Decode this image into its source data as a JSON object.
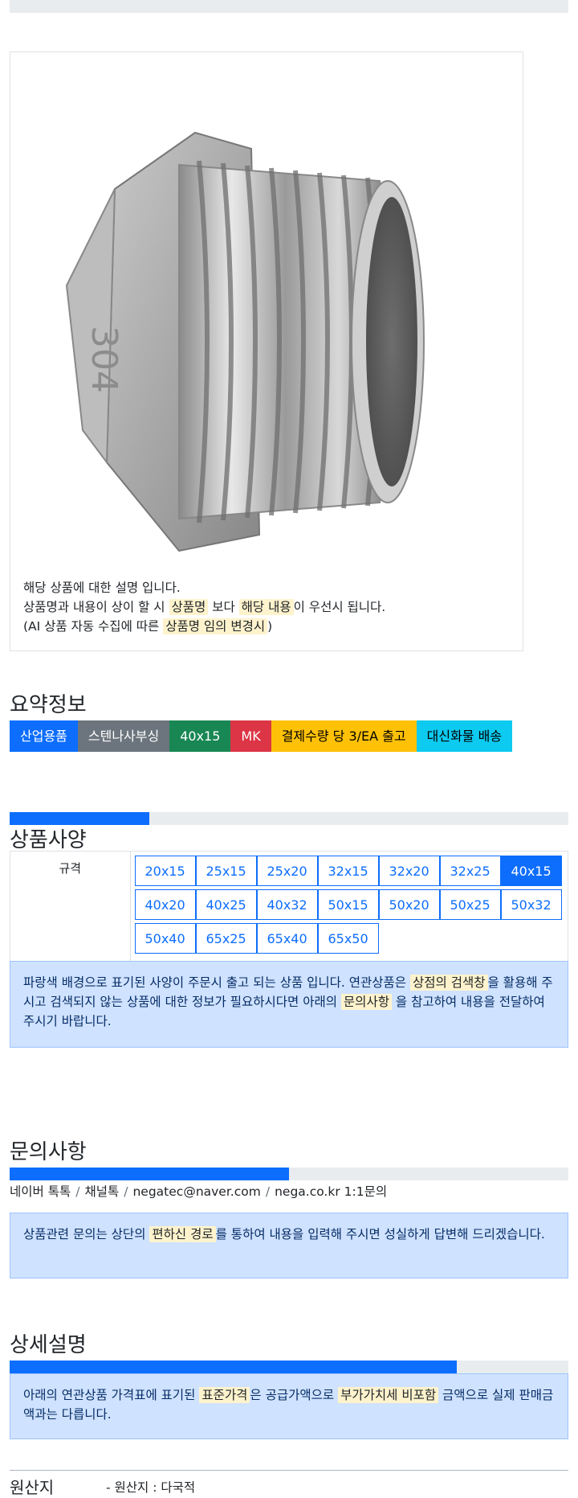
{
  "description": {
    "line1": "해당 상품에 대한 설명 입니다.",
    "line2_pre": "상품명과 내용이 상이 할 시 ",
    "line2_hl1": "상품명",
    "line2_mid": " 보다 ",
    "line2_hl2": "해당 내용",
    "line2_post": "이 우선시 됩니다.",
    "line3_pre": "(AI 상품 자동 수집에 따른 ",
    "line3_hl": "상품명 임의 변경시",
    "line3_post": ")"
  },
  "summary": {
    "title": "요약정보",
    "badges": [
      {
        "label": "산업용품",
        "color": "#0d6efd"
      },
      {
        "label": "스텐나사부싱",
        "color": "#6c757d"
      },
      {
        "label": "40x15",
        "color": "#198754"
      },
      {
        "label": "MK",
        "color": "#dc3545"
      },
      {
        "label": "결제수량 당 3/EA 출고",
        "color": "#ffc107",
        "text_color": "#000000"
      },
      {
        "label": "대신화물 배송",
        "color": "#0dcaf0",
        "text_color": "#000000"
      }
    ]
  },
  "spec": {
    "title": "상품사양",
    "progress_fraction": 0.25,
    "label": "규격",
    "sizes": [
      {
        "label": "20x15",
        "active": false
      },
      {
        "label": "25x15",
        "active": false
      },
      {
        "label": "25x20",
        "active": false
      },
      {
        "label": "32x15",
        "active": false
      },
      {
        "label": "32x20",
        "active": false
      },
      {
        "label": "32x25",
        "active": false
      },
      {
        "label": "40x15",
        "active": true
      },
      {
        "label": "40x20",
        "active": false
      },
      {
        "label": "40x25",
        "active": false
      },
      {
        "label": "40x32",
        "active": false
      },
      {
        "label": "50x15",
        "active": false
      },
      {
        "label": "50x20",
        "active": false
      },
      {
        "label": "50x25",
        "active": false
      },
      {
        "label": "50x32",
        "active": false
      },
      {
        "label": "50x40",
        "active": false
      },
      {
        "label": "65x25",
        "active": false
      },
      {
        "label": "65x40",
        "active": false
      },
      {
        "label": "65x50",
        "active": false
      }
    ],
    "notice_pre": "파랑색 배경으로 표기된 사양이 주문시 출고 되는 상품 입니다. 연관상품은 ",
    "notice_hl1": "상점의 검색창",
    "notice_mid": "을 활용해 주시고 검색되지 않는 상품에 대한 정보가 필요하시다면 아래의 ",
    "notice_hl2": "문의사항",
    "notice_post": " 을 참고하여 내용을 전달하여 주시기 바랍니다."
  },
  "inquiry": {
    "title": "문의사항",
    "progress_fraction": 0.5,
    "channels": [
      "네이버 톡톡",
      "채널톡",
      "negatec@naver.com",
      "nega.co.kr 1:1문의"
    ],
    "notice_pre": "상품관련 문의는 상단의 ",
    "notice_hl": "편하신 경로",
    "notice_post": "를 통하여 내용을 입력해 주시면 성실하게 답변해 드리겠습니다."
  },
  "detail": {
    "title": "상세설명",
    "progress_fraction": 0.8,
    "notice_pre": "아래의 연관상품 가격표에 표기된 ",
    "notice_hl1": "표준가격",
    "notice_mid": "은 공급가액으로 ",
    "notice_hl2": "부가가치세 비포함",
    "notice_post": " 금액으로 실제 판매금액과는 다릅니다."
  },
  "origin": {
    "label": "원산지",
    "value": "- 원산지 : 다국적"
  }
}
